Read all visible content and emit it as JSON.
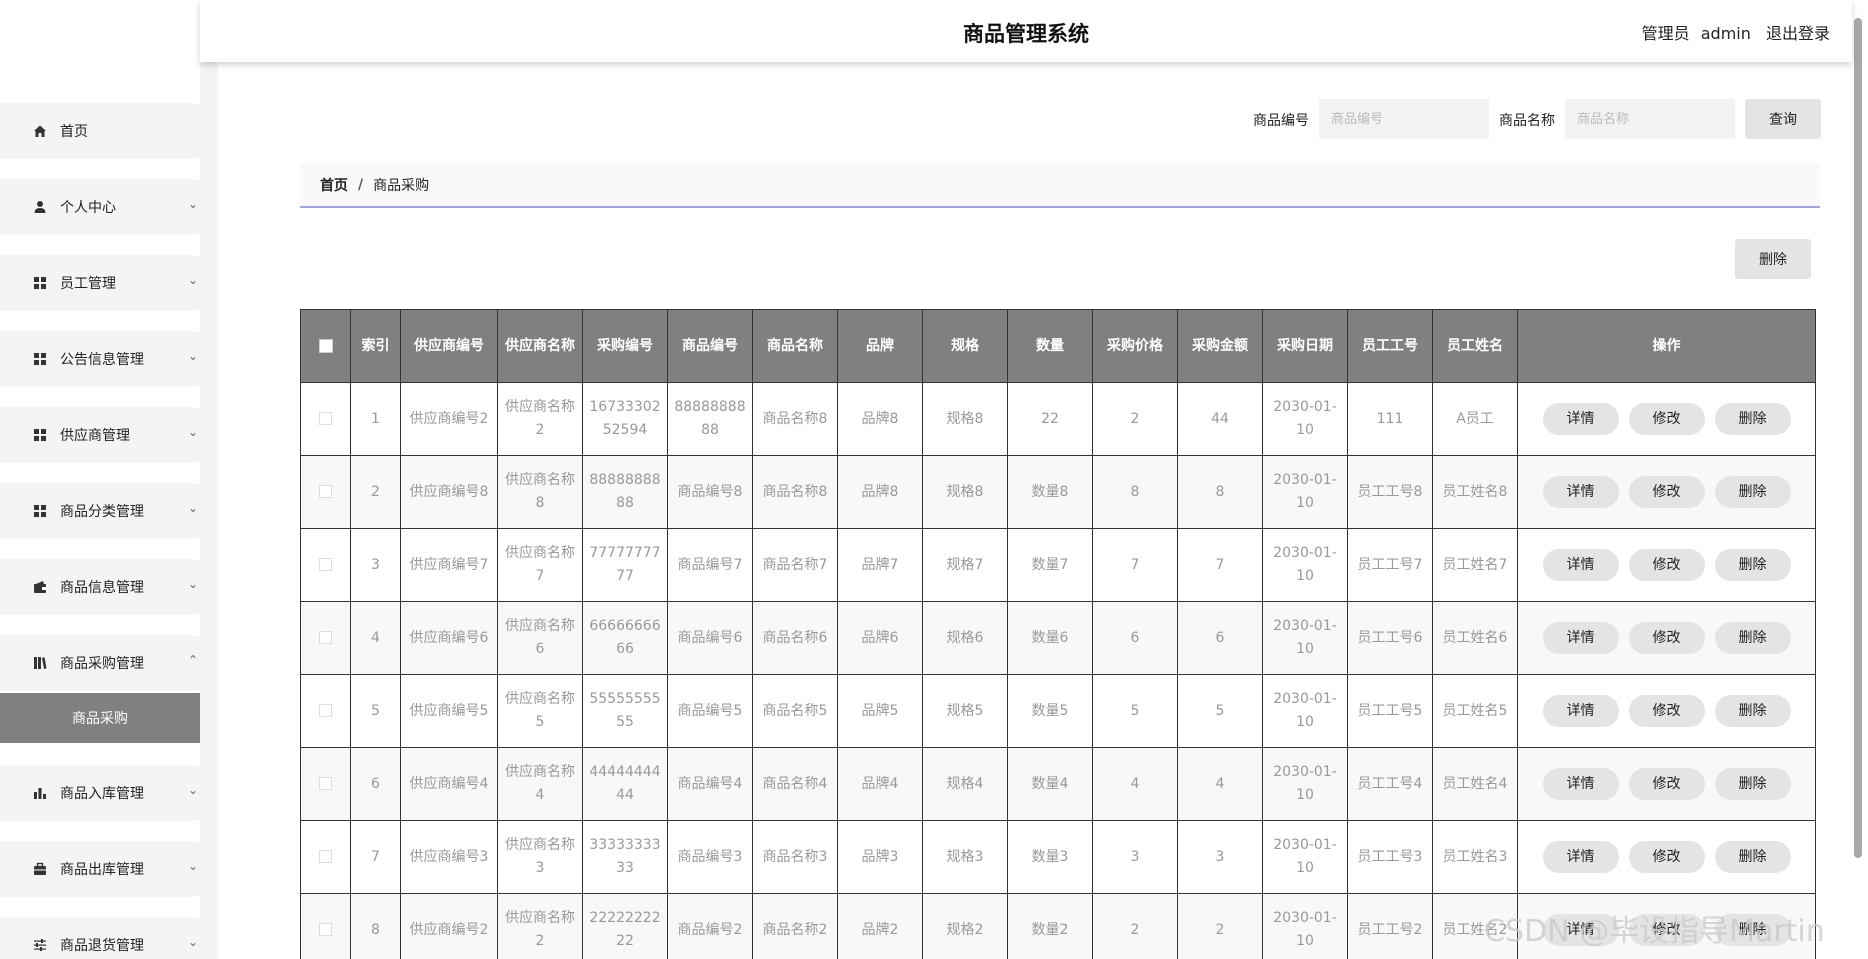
{
  "header": {
    "title": "商品管理系统",
    "user_role": "管理员",
    "username": "admin",
    "logout": "退出登录"
  },
  "sidebar": {
    "items": [
      {
        "label": "首页",
        "icon": "home-icon",
        "chevron": ""
      },
      {
        "label": "个人中心",
        "icon": "user-icon",
        "chevron": "⌄"
      },
      {
        "label": "员工管理",
        "icon": "grid-icon",
        "chevron": "⌄"
      },
      {
        "label": "公告信息管理",
        "icon": "grid-icon",
        "chevron": "⌄"
      },
      {
        "label": "供应商管理",
        "icon": "grid-icon",
        "chevron": "⌄"
      },
      {
        "label": "商品分类管理",
        "icon": "grid-icon",
        "chevron": "⌄"
      },
      {
        "label": "商品信息管理",
        "icon": "wallet-icon",
        "chevron": "⌄"
      },
      {
        "label": "商品采购管理",
        "icon": "books-icon",
        "chevron": "⌃"
      },
      {
        "label": "商品入库管理",
        "icon": "bar-chart-icon",
        "chevron": "⌄"
      },
      {
        "label": "商品出库管理",
        "icon": "briefcase-icon",
        "chevron": "⌄"
      },
      {
        "label": "商品退货管理",
        "icon": "sliders-icon",
        "chevron": "⌄"
      }
    ],
    "active_sub": "商品采购"
  },
  "search": {
    "code_label": "商品编号",
    "code_placeholder": "商品编号",
    "name_label": "商品名称",
    "name_placeholder": "商品名称",
    "query_button": "查询"
  },
  "breadcrumb": {
    "home": "首页",
    "sep": "/",
    "current": "商品采购"
  },
  "toolbar": {
    "delete_button": "删除"
  },
  "table": {
    "headers": [
      "索引",
      "供应商编号",
      "供应商名称",
      "采购编号",
      "商品编号",
      "商品名称",
      "品牌",
      "规格",
      "数量",
      "采购价格",
      "采购金额",
      "采购日期",
      "员工工号",
      "员工姓名",
      "操作"
    ],
    "actions": [
      "详情",
      "修改",
      "删除"
    ],
    "rows": [
      [
        "1",
        "供应商编号2",
        "供应商名称2",
        "1673330252594",
        "8888888888",
        "商品名称8",
        "品牌8",
        "规格8",
        "22",
        "2",
        "44",
        "2030-01-10",
        "111",
        "A员工"
      ],
      [
        "2",
        "供应商编号8",
        "供应商名称8",
        "8888888888",
        "商品编号8",
        "商品名称8",
        "品牌8",
        "规格8",
        "数量8",
        "8",
        "8",
        "2030-01-10",
        "员工工号8",
        "员工姓名8"
      ],
      [
        "3",
        "供应商编号7",
        "供应商名称7",
        "7777777777",
        "商品编号7",
        "商品名称7",
        "品牌7",
        "规格7",
        "数量7",
        "7",
        "7",
        "2030-01-10",
        "员工工号7",
        "员工姓名7"
      ],
      [
        "4",
        "供应商编号6",
        "供应商名称6",
        "6666666666",
        "商品编号6",
        "商品名称6",
        "品牌6",
        "规格6",
        "数量6",
        "6",
        "6",
        "2030-01-10",
        "员工工号6",
        "员工姓名6"
      ],
      [
        "5",
        "供应商编号5",
        "供应商名称5",
        "5555555555",
        "商品编号5",
        "商品名称5",
        "品牌5",
        "规格5",
        "数量5",
        "5",
        "5",
        "2030-01-10",
        "员工工号5",
        "员工姓名5"
      ],
      [
        "6",
        "供应商编号4",
        "供应商名称4",
        "4444444444",
        "商品编号4",
        "商品名称4",
        "品牌4",
        "规格4",
        "数量4",
        "4",
        "4",
        "2030-01-10",
        "员工工号4",
        "员工姓名4"
      ],
      [
        "7",
        "供应商编号3",
        "供应商名称3",
        "3333333333",
        "商品编号3",
        "商品名称3",
        "品牌3",
        "规格3",
        "数量3",
        "3",
        "3",
        "2030-01-10",
        "员工工号3",
        "员工姓名3"
      ],
      [
        "8",
        "供应商编号2",
        "供应商名称2",
        "2222222222",
        "商品编号2",
        "商品名称2",
        "品牌2",
        "规格2",
        "数量2",
        "2",
        "2",
        "2030-01-10",
        "员工工号2",
        "员工姓名2"
      ]
    ]
  },
  "watermark": "CSDN @毕设指导Martin"
}
